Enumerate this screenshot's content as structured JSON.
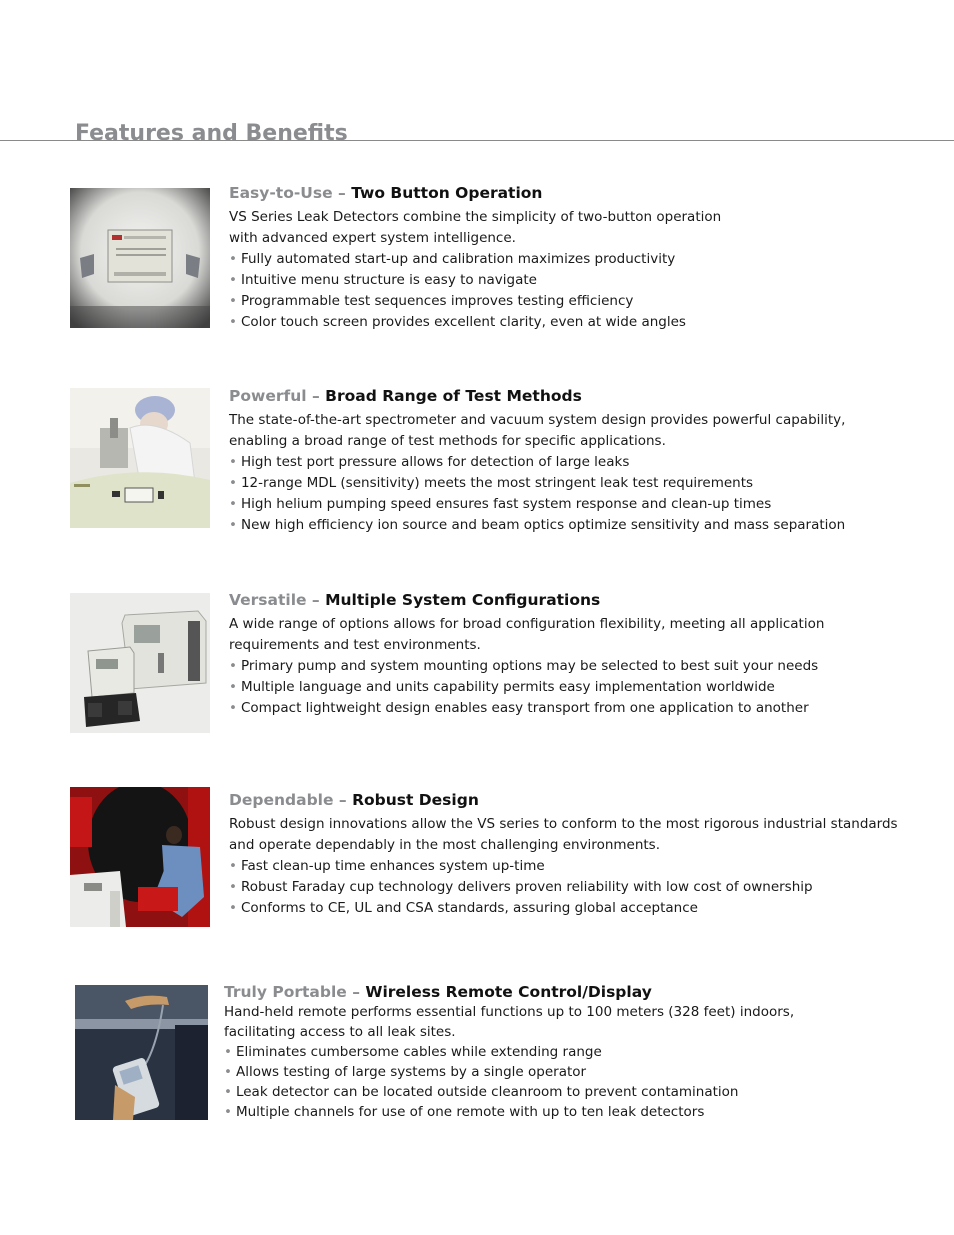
{
  "page": {
    "title": "Features and Benefits"
  },
  "colors": {
    "lead_gray": "#8a8c8f",
    "title_black": "#111111",
    "rule": "#8a8a8a"
  },
  "sections": [
    {
      "lead": "Easy-to-Use –",
      "title": "Two Button Operation",
      "intro": [
        "VS Series Leak Detectors combine the simplicity of two-button operation",
        "with advanced expert system intelligence."
      ],
      "bullets": [
        "Fully automated start-up and calibration maximizes productivity",
        "Intuitive menu structure is easy to navigate",
        "Programmable test sequences improves testing efficiency",
        "Color touch screen provides excellent clarity, even at wide angles"
      ],
      "image": "touch-screen-control-panel-photo"
    },
    {
      "lead": "Powerful –",
      "title": "Broad Range of Test Methods",
      "intro": [
        "The state-of-the-art spectrometer and vacuum system design provides powerful capability,",
        "enabling a broad range of test methods for specific applications."
      ],
      "bullets": [
        "High test port pressure allows for detection of large leaks",
        "12-range MDL (sensitivity) meets the most stringent leak test requirements",
        "High helium pumping speed ensures fast system response and clean-up times",
        "New high efficiency ion source and beam optics optimize sensitivity and mass separation"
      ],
      "image": "cleanroom-technician-photo"
    },
    {
      "lead": "Versatile –",
      "title": "Multiple System Configurations",
      "intro": [
        "A wide range of options allows for broad configuration flexibility, meeting all application",
        "requirements and test environments."
      ],
      "bullets": [
        "Primary pump and system mounting options may be selected to best suit your needs",
        "Multiple language and units capability permits easy implementation worldwide",
        "Compact lightweight design enables easy transport from one application to another"
      ],
      "image": "leak-detector-configurations-photo"
    },
    {
      "lead": "Dependable –",
      "title": "Robust Design",
      "intro": [
        "Robust design innovations allow the VS series to conform to the most rigorous industrial standards",
        "and operate dependably in the most challenging environments."
      ],
      "bullets": [
        "Fast clean-up time enhances system up-time",
        "Robust Faraday cup technology delivers proven reliability with low cost of ownership",
        "Conforms to CE, UL and CSA standards, assuring global acceptance"
      ],
      "image": "industrial-operator-photo"
    },
    {
      "lead": "Truly Portable –",
      "title": "Wireless Remote Control/Display",
      "intro": [
        "Hand-held remote performs essential functions up to 100 meters (328 feet) indoors,",
        "facilitating access to all leak sites."
      ],
      "bullets": [
        "Eliminates cumbersome cables while extending range",
        "Allows testing of large systems by a single operator",
        "Leak detector can be located outside cleanroom to prevent contamination",
        "Multiple channels for use of one remote with up to ten leak detectors"
      ],
      "image": "handheld-remote-photo"
    }
  ],
  "bullet_glyph": "•"
}
